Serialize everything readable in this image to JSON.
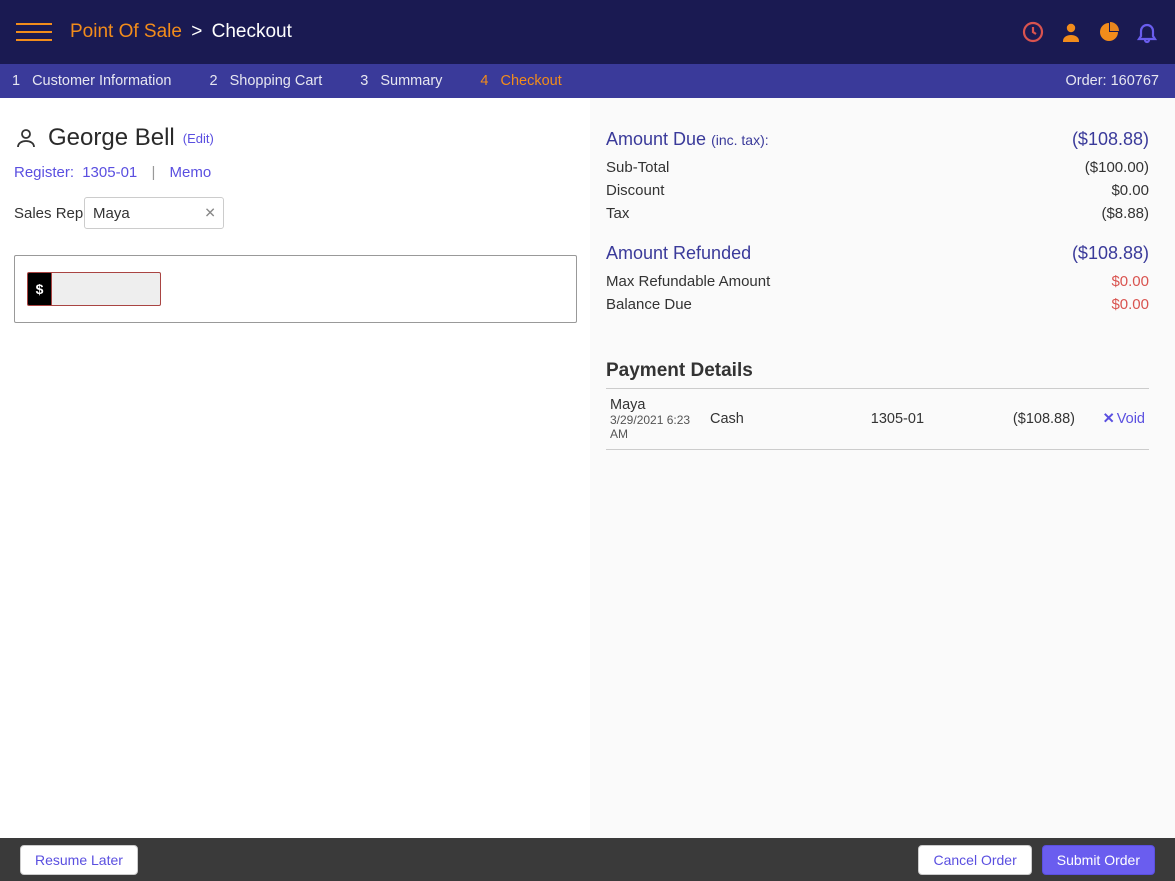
{
  "header": {
    "brand": "Point Of Sale",
    "page": "Checkout"
  },
  "steps": [
    {
      "num": "1",
      "label": "Customer Information"
    },
    {
      "num": "2",
      "label": "Shopping Cart"
    },
    {
      "num": "3",
      "label": "Summary"
    },
    {
      "num": "4",
      "label": "Checkout"
    }
  ],
  "active_step": 3,
  "order_label": "Order: 160767",
  "customer": {
    "name": "George Bell",
    "edit": "(Edit)"
  },
  "register": {
    "label": "Register:",
    "value": "1305-01",
    "memo": "Memo"
  },
  "sales_rep": {
    "label": "Sales Rep",
    "value": "Maya"
  },
  "amount_input": "",
  "summary": {
    "amount_due_label": "Amount Due",
    "amount_due_sub": "(inc. tax):",
    "amount_due_value": "($108.88)",
    "subtotal_label": "Sub-Total",
    "subtotal_value": "($100.00)",
    "discount_label": "Discount",
    "discount_value": "$0.00",
    "tax_label": "Tax",
    "tax_value": "($8.88)",
    "refunded_label": "Amount Refunded",
    "refunded_value": "($108.88)",
    "max_refund_label": "Max Refundable Amount",
    "max_refund_value": "$0.00",
    "balance_label": "Balance Due",
    "balance_value": "$0.00"
  },
  "payment_details": {
    "title": "Payment Details",
    "rows": [
      {
        "user": "Maya",
        "date": "3/29/2021 6:23 AM",
        "method": "Cash",
        "reg": "1305-01",
        "amount": "($108.88)",
        "void": "Void"
      }
    ]
  },
  "footer": {
    "resume": "Resume Later",
    "cancel": "Cancel Order",
    "submit": "Submit Order"
  }
}
